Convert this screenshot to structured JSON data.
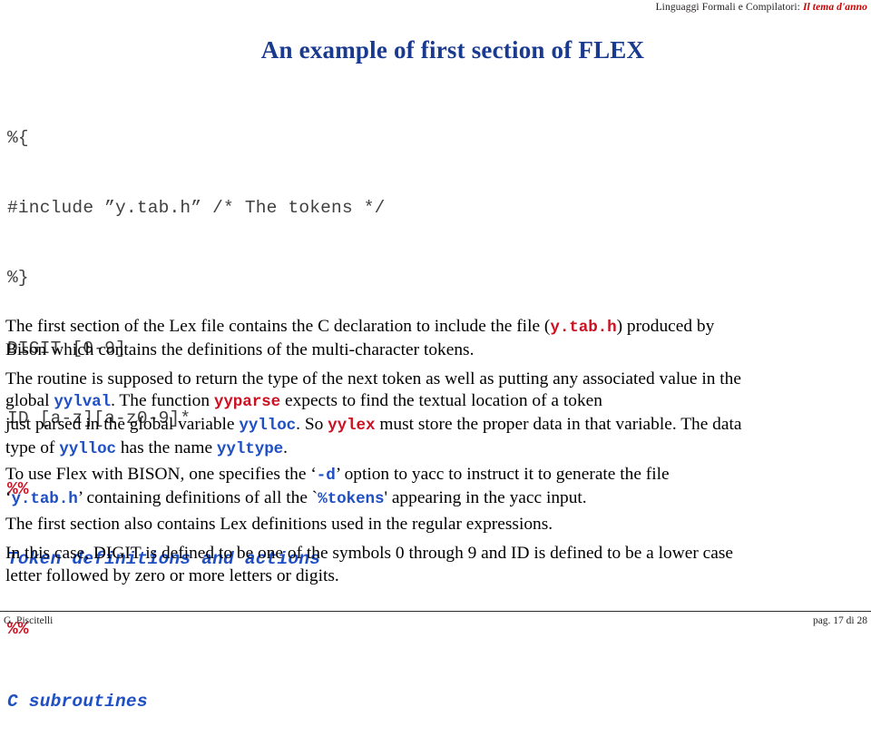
{
  "header": {
    "course": "Linguaggi Formali e Compilatori: ",
    "accent": "Il tema d'anno"
  },
  "title": "An example of first section of FLEX",
  "code": {
    "lines": [
      {
        "text": "%{",
        "style": "plain"
      },
      {
        "text": "#include ”y.tab.h” /* The tokens */",
        "style": "plain"
      },
      {
        "text": "%}",
        "style": "plain"
      },
      {
        "text": "DIGIT [0-9]",
        "style": "plain"
      },
      {
        "text": "ID [a-z][a-z0-9]*",
        "style": "plain"
      },
      {
        "text": "%%",
        "style": "marker"
      },
      {
        "text": "Token definitions and actions",
        "style": "section"
      },
      {
        "text": "%%",
        "style": "marker"
      },
      {
        "text": "C subroutines",
        "style": "section"
      }
    ]
  },
  "paragraphs": {
    "p1_l1_a": "The first section of the Lex file contains the C declaration to include the file (",
    "p1_l1_code": "y.tab.h",
    "p1_l1_b": ") produced by",
    "p1_l2": "Bison which contains the definitions of the multi-character tokens.",
    "p2_l1": "The routine is supposed to return the type of the next token as well as putting any associated value in the",
    "p2_l2_a": "global ",
    "p2_l2_code1": "yylval",
    "p2_l2_b": ". The function ",
    "p2_l2_code2": "yyparse",
    "p2_l2_c": " expects to find the textual location of a token",
    "p2_l3_a": "just parsed in the global variable ",
    "p2_l3_code1": "yylloc",
    "p2_l3_b": ". So ",
    "p2_l3_code2": "yylex",
    "p2_l3_c": " must store the proper data in that variable. The data",
    "p2_l4_a": "type of ",
    "p2_l4_code1": "yylloc",
    "p2_l4_b": " has the name ",
    "p2_l4_code2": "yyltype",
    "p2_l4_c": ".",
    "p3_l1_a": "To use Flex with BISON, one specifies the ‘",
    "p3_l1_code": "-d",
    "p3_l1_b": "’ option to yacc to instruct it to generate the file",
    "p3_l2_a": "‘",
    "p3_l2_code1": "y.tab.h",
    "p3_l2_b": "’ containing definitions of all the `",
    "p3_l2_code2": "%tokens",
    "p3_l2_c": "' appearing in the yacc input.",
    "p4": "The first section also contains Lex definitions used in the regular expressions.",
    "p5_l1": "In this case, DIGIT is defined to be one of the symbols 0 through 9 and ID is defined to be a lower case",
    "p5_l2": "letter followed by zero or more letters or digits."
  },
  "footer": {
    "author": "G. Piscitelli",
    "page": "pag. 17 di 28"
  },
  "colors": {
    "title_blue": "#1a3a8f",
    "code_blue": "#1f4fc4",
    "code_red": "#cc1122",
    "accent_red": "#cc0000"
  }
}
